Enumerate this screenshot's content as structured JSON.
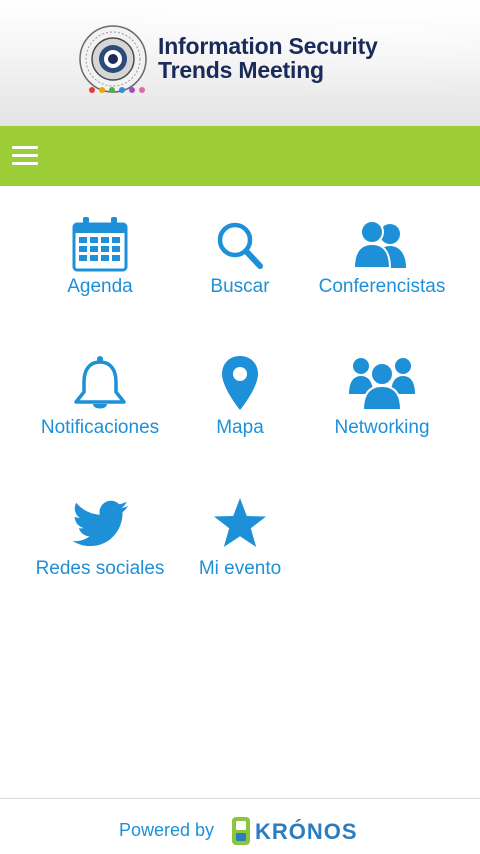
{
  "header": {
    "title_line1": "Information Security",
    "title_line2": "Trends Meeting"
  },
  "navbar": {
    "color": "#9ccd36",
    "menu_icon": "hamburger-icon"
  },
  "menu_items": [
    {
      "label": "Agenda",
      "icon": "calendar-icon"
    },
    {
      "label": "Buscar",
      "icon": "search-icon"
    },
    {
      "label": "Conferencistas",
      "icon": "speakers-icon"
    },
    {
      "label": "Notificaciones",
      "icon": "bell-icon"
    },
    {
      "label": "Mapa",
      "icon": "map-pin-icon"
    },
    {
      "label": "Networking",
      "icon": "group-icon"
    },
    {
      "label": "Redes sociales",
      "icon": "twitter-icon"
    },
    {
      "label": "Mi evento",
      "icon": "star-icon"
    }
  ],
  "accent_color": "#1e90d8",
  "footer": {
    "powered_by": "Powered by",
    "brand": "KRÓNOS"
  }
}
